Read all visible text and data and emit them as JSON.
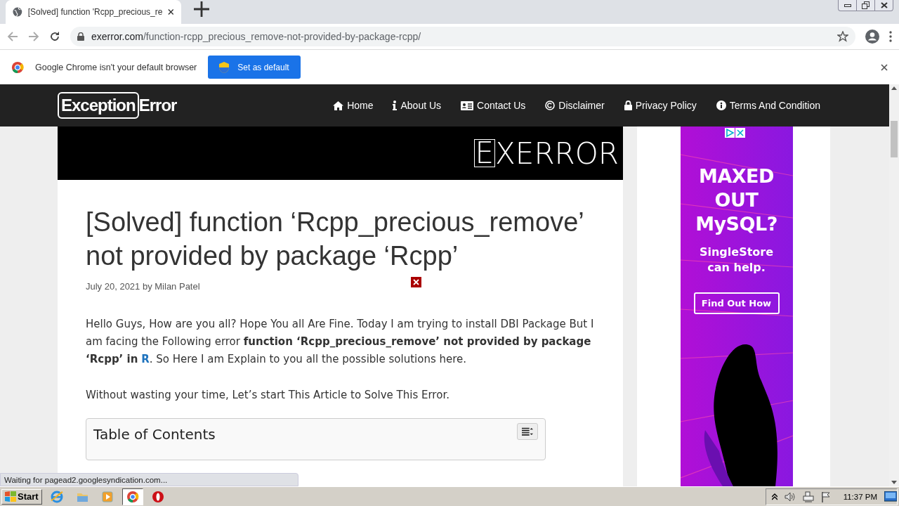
{
  "browser": {
    "tabs": [
      {
        "title": "[Solved] function 'Rcpp_precious_re",
        "selected": true
      }
    ],
    "url_host": "exerror.com",
    "url_path": "/function-rcpp_precious_remove-not-provided-by-package-rcpp/"
  },
  "infobar": {
    "message": "Google Chrome isn't your default browser",
    "button": "Set as default"
  },
  "site": {
    "logo_boxed": "Exception",
    "logo_rest": "Error",
    "nav": [
      {
        "label": "Home"
      },
      {
        "label": "About Us"
      },
      {
        "label": "Contact Us"
      },
      {
        "label": "Disclaimer"
      },
      {
        "label": "Privacy Policy"
      },
      {
        "label": "Terms And Condition"
      }
    ]
  },
  "banner": {
    "boxed_letter": "E",
    "rest": "XERROR"
  },
  "article": {
    "title": "[Solved] function ‘Rcpp_precious_remove’ not provided by package ‘Rcpp’",
    "byline": "July 20, 2021 by Milan Patel",
    "intro_before": "Hello Guys, How are you all? Hope You all Are Fine. Today I am trying to install DBI Package But I am facing the Following error **function ‘Rcpp_precious_remove’ not provided by package ‘Rcpp’ in** ",
    "intro_link": "R",
    "intro_after": ". So Here I am Explain to you all the possible solutions here.",
    "lead": "Without wasting your time, Let’s start This Article to Solve This Error.",
    "toc_title": "Table of Contents"
  },
  "ad": {
    "headline": [
      "MAXED",
      "OUT",
      "MySQL?"
    ],
    "sub": [
      "SingleStore",
      "can help."
    ],
    "button": "Find Out How"
  },
  "status_text": "Waiting for pagead2.googlesyndication.com...",
  "taskbar": {
    "start": "Start",
    "apps": [
      {
        "kind": "ie",
        "selected": false
      },
      {
        "kind": "folder",
        "selected": false
      },
      {
        "kind": "media",
        "selected": false
      },
      {
        "kind": "chrome",
        "selected": true
      },
      {
        "kind": "opera",
        "selected": false
      }
    ],
    "clock": "11:37 PM"
  }
}
